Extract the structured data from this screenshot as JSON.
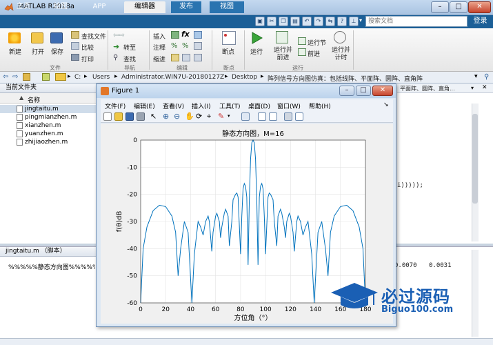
{
  "window": {
    "title": "MATLAB R2018a"
  },
  "tabs": [
    {
      "label": "主页"
    },
    {
      "label": "绘图"
    },
    {
      "label": "APP"
    },
    {
      "label": "编辑器"
    },
    {
      "label": "发布"
    },
    {
      "label": "视图"
    }
  ],
  "search": {
    "placeholder": "搜索文档"
  },
  "login_label": "登录",
  "ribbon": {
    "new_label": "新建",
    "open_label": "打开",
    "save_label": "保存",
    "find_files_label": "查找文件",
    "compare_label": "比较",
    "print_label": "打印",
    "goto_label": "转至",
    "find_label": "查找",
    "insert_label": "插入",
    "comment_label": "注释",
    "indent_label": "缩进",
    "fx_label": "fx",
    "breakpoints_label": "断点",
    "run_label": "运行",
    "run_advance_label": "运行并\n前进",
    "run_section_label": "运行节",
    "advance_label": "前进",
    "run_time_label": "运行并\n计时",
    "groups": {
      "file": "文件",
      "nav": "导航",
      "edit": "编辑",
      "breakpoints": "断点",
      "run": "运行"
    }
  },
  "address": {
    "path": [
      "C:",
      "Users",
      "Administrator.WIN7U-20180127Z",
      "Desktop",
      "阵列信号方向图仿真：包括线阵、平面阵、圆阵、直角阵"
    ]
  },
  "editor_tab_label": "平面阵、圆阵、直角...",
  "editor_code_fragment": "i)))));",
  "current_folder": {
    "title": "当前文件夹",
    "column_name": "名称",
    "files": [
      "jingtaitu.m",
      "pingmianzhen.m",
      "xianzhen.m",
      "yuanzhen.m",
      "zhijiaozhen.m"
    ],
    "selected_index": 0
  },
  "details": {
    "header": "jingtaitu.m  （脚本）",
    "content": "%%%%%静态方向图%%%%%%%"
  },
  "command_output": [
    "0.0070",
    "0.0031"
  ],
  "figure": {
    "title": "Figure 1",
    "menus": [
      "文件(F)",
      "编辑(E)",
      "查看(V)",
      "插入(I)",
      "工具(T)",
      "桌面(D)",
      "窗口(W)",
      "帮助(H)"
    ]
  },
  "watermark": {
    "text": "必过源码",
    "url": "Biguo100.com"
  },
  "colors": {
    "tab_bar": "#1b5f97",
    "plot_line": "#0072bd",
    "watermark": "#1a5fb4"
  },
  "chart_data": {
    "type": "line",
    "title": "静态方向图，M=16",
    "xlabel": "方位角（°）",
    "ylabel": "f(θ)dB",
    "xlim": [
      0,
      180
    ],
    "ylim": [
      -60,
      0
    ],
    "xticks": [
      0,
      20,
      40,
      60,
      80,
      100,
      120,
      140,
      160,
      180
    ],
    "yticks": [
      0,
      -10,
      -20,
      -30,
      -40,
      -50,
      -60
    ],
    "grid": true,
    "series": [
      {
        "name": "",
        "x": [
          0,
          2,
          5,
          10,
          15,
          20,
          25,
          28,
          30,
          32,
          35,
          38,
          41,
          43,
          46,
          48,
          50,
          52,
          54,
          55,
          57,
          58,
          60,
          61,
          63,
          64,
          65,
          67,
          68,
          70,
          71,
          73,
          74,
          76,
          77,
          78,
          80,
          81,
          82,
          83,
          84,
          85,
          86,
          87,
          88,
          89,
          90,
          91,
          92,
          93,
          94,
          95,
          96,
          97,
          98,
          99,
          100,
          102,
          103,
          104,
          106,
          107,
          109,
          110,
          112,
          113,
          115,
          116,
          117,
          119,
          120,
          122,
          123,
          125,
          126,
          128,
          130,
          132,
          134,
          137,
          139,
          142,
          145,
          148,
          150,
          152,
          155,
          160,
          165,
          170,
          175,
          178,
          180
        ],
        "y": [
          -60,
          -40,
          -32,
          -26,
          -24,
          -24.5,
          -28,
          -34,
          -50,
          -40,
          -30,
          -34,
          -60,
          -42,
          -30,
          -32,
          -35,
          -30,
          -28,
          -30,
          -41,
          -34,
          -28,
          -27,
          -30,
          -36,
          -32,
          -27,
          -25.5,
          -28,
          -39,
          -30,
          -22,
          -20,
          -19.5,
          -21,
          -42,
          -28,
          -18,
          -16,
          -17,
          -21,
          -46,
          -22,
          -7,
          -1,
          0,
          -1,
          -7,
          -22,
          -46,
          -21,
          -17,
          -16,
          -18,
          -28,
          -42,
          -21,
          -19.5,
          -20,
          -22,
          -30,
          -39,
          -28,
          -25.5,
          -27,
          -32,
          -36,
          -30,
          -27,
          -28,
          -34,
          -41,
          -30,
          -28,
          -30,
          -35,
          -32,
          -30,
          -42,
          -60,
          -34,
          -30,
          -40,
          -50,
          -34,
          -28,
          -24.5,
          -24,
          -26,
          -32,
          -40,
          -60
        ]
      }
    ]
  }
}
